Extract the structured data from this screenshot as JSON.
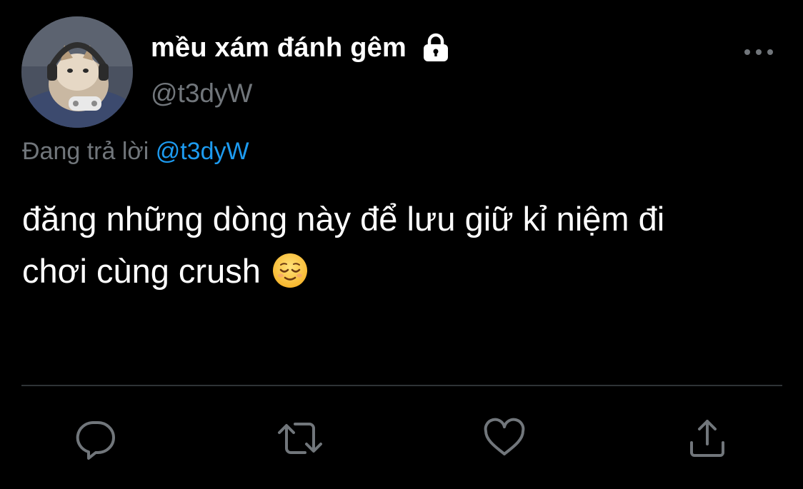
{
  "author": {
    "display_name": "mều xám đánh gêm",
    "handle": "@t3dyW",
    "protected": true,
    "avatar_icon": "cat-with-headset-avatar"
  },
  "reply_context": {
    "prefix": "Đang trả lời",
    "mention": "@t3dyW"
  },
  "tweet": {
    "line1": "đăng những dòng này để lưu giữ kỉ niệm đi",
    "line2": "chơi cùng crush",
    "emoji": "😌"
  },
  "actions": [
    {
      "name": "reply",
      "icon": "reply-icon"
    },
    {
      "name": "retweet",
      "icon": "retweet-icon"
    },
    {
      "name": "like",
      "icon": "heart-icon"
    },
    {
      "name": "share",
      "icon": "share-icon"
    }
  ],
  "colors": {
    "background": "#000000",
    "primary_text": "#ffffff",
    "secondary_text": "#71767b",
    "link": "#1d9bf0",
    "divider": "#2f3336"
  }
}
